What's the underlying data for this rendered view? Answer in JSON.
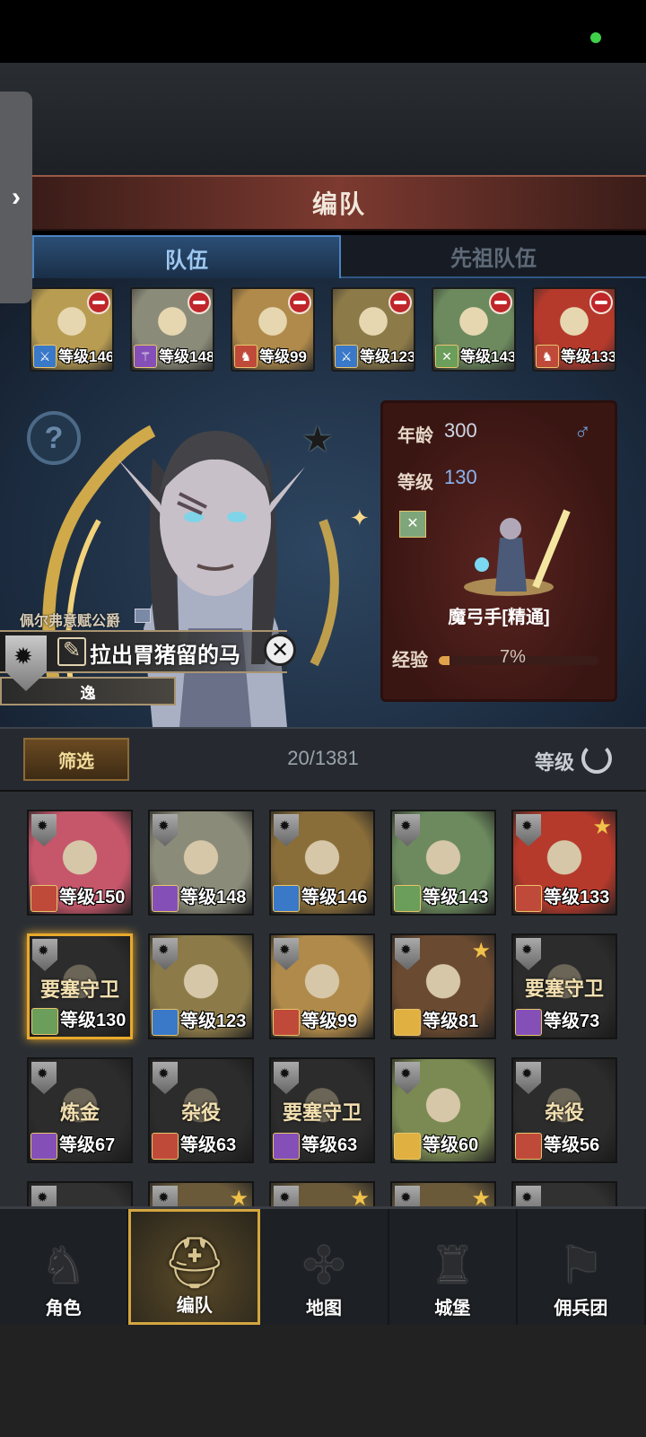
{
  "window": {
    "title": "编队"
  },
  "tabs": [
    {
      "label": "队伍",
      "active": true
    },
    {
      "label": "先祖队伍",
      "active": false
    }
  ],
  "team": [
    {
      "level_label": "等级146",
      "class_icon": "sword-icon",
      "class_color": "#3a78c8",
      "portrait": "#b89c52"
    },
    {
      "level_label": "等级148",
      "class_icon": "staff-icon",
      "class_color": "#8450b8",
      "portrait": "#8b8b7a"
    },
    {
      "level_label": "等级99",
      "class_icon": "horse-icon",
      "class_color": "#c04a3a",
      "portrait": "#b08a4a"
    },
    {
      "level_label": "等级123",
      "class_icon": "sword-icon",
      "class_color": "#3a78c8",
      "portrait": "#8c7a48"
    },
    {
      "level_label": "等级143",
      "class_icon": "crossbow-icon",
      "class_color": "#6a9e5a",
      "portrait": "#6c8a5e"
    },
    {
      "level_label": "等级133",
      "class_icon": "horse-icon",
      "class_color": "#c04a3a",
      "portrait": "#b53a2c"
    }
  ],
  "hero": {
    "title": "佩尔弗意赋公爵",
    "name": "拉出胃猪留的马",
    "trait": "逸",
    "age_label": "年龄",
    "age": "300",
    "level_label": "等级",
    "level": "130",
    "class_name": "魔弓手[精通]",
    "exp_label": "经验",
    "exp": "7%",
    "exp_fraction": 0.07
  },
  "filter": {
    "button": "筛选",
    "count": "20/1381",
    "sort": "等级"
  },
  "roster": [
    {
      "level_label": "等级150",
      "job": "",
      "class_color": "#c04a3a",
      "portrait": "#c6566a",
      "star": false,
      "dim": false,
      "selected": false
    },
    {
      "level_label": "等级148",
      "job": "",
      "class_color": "#8450b8",
      "portrait": "#8b8b7a",
      "star": false,
      "dim": false,
      "selected": false
    },
    {
      "level_label": "等级146",
      "job": "",
      "class_color": "#3a78c8",
      "portrait": "#8a6e3a",
      "star": false,
      "dim": false,
      "selected": false
    },
    {
      "level_label": "等级143",
      "job": "",
      "class_color": "#6a9e5a",
      "portrait": "#6c8a5e",
      "star": false,
      "dim": false,
      "selected": false
    },
    {
      "level_label": "等级133",
      "job": "",
      "class_color": "#c04a3a",
      "portrait": "#b53a2c",
      "star": true,
      "dim": false,
      "selected": false
    },
    {
      "level_label": "等级130",
      "job": "要塞守卫",
      "class_color": "#6a9e5a",
      "portrait": "#4a4a4a",
      "star": false,
      "dim": true,
      "selected": true
    },
    {
      "level_label": "等级123",
      "job": "",
      "class_color": "#3a78c8",
      "portrait": "#8c7a48",
      "star": false,
      "dim": false,
      "selected": false
    },
    {
      "level_label": "等级99",
      "job": "",
      "class_color": "#c04a3a",
      "portrait": "#b08a4a",
      "star": false,
      "dim": false,
      "selected": false
    },
    {
      "level_label": "等级81",
      "job": "",
      "class_color": "#e0b040",
      "portrait": "#6a4a30",
      "star": true,
      "dim": false,
      "selected": false
    },
    {
      "level_label": "等级73",
      "job": "要塞守卫",
      "class_color": "#8450b8",
      "portrait": "#4a4a4a",
      "star": false,
      "dim": true,
      "selected": false
    },
    {
      "level_label": "等级67",
      "job": "炼金",
      "class_color": "#8450b8",
      "portrait": "#4a4a4a",
      "star": false,
      "dim": true,
      "selected": false
    },
    {
      "level_label": "等级63",
      "job": "杂役",
      "class_color": "#c04a3a",
      "portrait": "#4a4a4a",
      "star": false,
      "dim": true,
      "selected": false
    },
    {
      "level_label": "等级63",
      "job": "要塞守卫",
      "class_color": "#8450b8",
      "portrait": "#4a4a4a",
      "star": false,
      "dim": true,
      "selected": false
    },
    {
      "level_label": "等级60",
      "job": "",
      "class_color": "#e0b040",
      "portrait": "#7a8a52",
      "star": false,
      "dim": false,
      "selected": false
    },
    {
      "level_label": "等级56",
      "job": "杂役",
      "class_color": "#c04a3a",
      "portrait": "#4a4a4a",
      "star": false,
      "dim": true,
      "selected": false
    },
    {
      "level_label": "",
      "job": "",
      "class_color": "#444",
      "portrait": "#555",
      "star": false,
      "dim": true,
      "selected": false
    },
    {
      "level_label": "",
      "job": "",
      "class_color": "#444",
      "portrait": "#6a5a3a",
      "star": true,
      "dim": false,
      "selected": false
    },
    {
      "level_label": "",
      "job": "",
      "class_color": "#444",
      "portrait": "#6a5a3a",
      "star": true,
      "dim": false,
      "selected": false
    },
    {
      "level_label": "",
      "job": "",
      "class_color": "#444",
      "portrait": "#6a5a3a",
      "star": true,
      "dim": false,
      "selected": false
    },
    {
      "level_label": "",
      "job": "",
      "class_color": "#444",
      "portrait": "#555",
      "star": false,
      "dim": true,
      "selected": false
    }
  ],
  "nav": [
    {
      "label": "角色",
      "icon": "knight-icon",
      "glyph": "♞",
      "active": false
    },
    {
      "label": "编队",
      "icon": "helmet-icon",
      "glyph": "⛑",
      "active": true
    },
    {
      "label": "地图",
      "icon": "compass-icon",
      "glyph": "✣",
      "active": false
    },
    {
      "label": "城堡",
      "icon": "castle-icon",
      "glyph": "♜",
      "active": false
    },
    {
      "label": "佣兵团",
      "icon": "banner-icon",
      "glyph": "⚑",
      "active": false
    }
  ]
}
